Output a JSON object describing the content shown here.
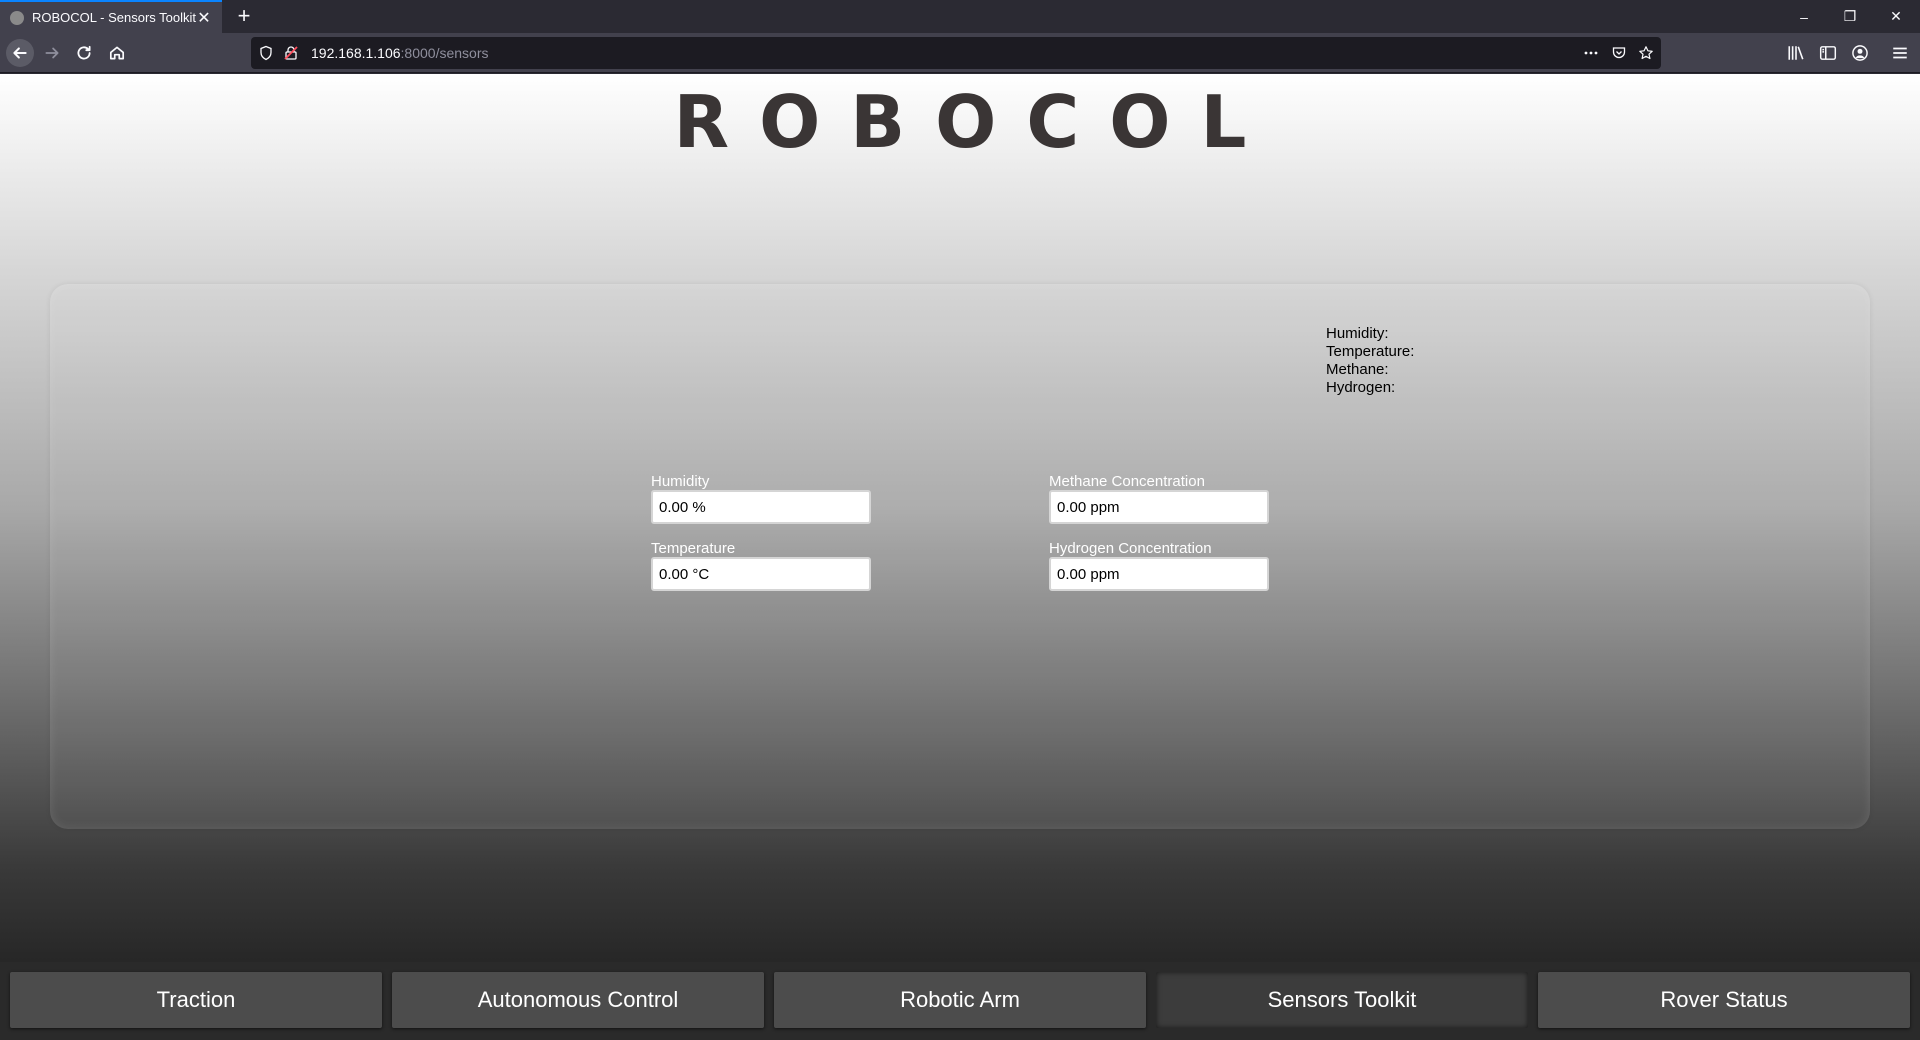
{
  "browser": {
    "tab_title": "ROBOCOL - Sensors Toolkit",
    "tab_close": "✕",
    "new_tab": "+",
    "url_host": "192.168.1.106",
    "url_rest": ":8000/sensors",
    "window_controls": [
      "–",
      "❐",
      "✕"
    ]
  },
  "header": {
    "logo": "ROBOCOL"
  },
  "readouts": {
    "humidity": "Humidity:",
    "temperature": "Temperature:",
    "methane": "Methane:",
    "hydrogen": "Hydrogen:"
  },
  "sensors": {
    "humidity": {
      "label": "Humidity",
      "value": "0.00 %"
    },
    "temperature": {
      "label": "Temperature",
      "value": "0.00 °C"
    },
    "methane": {
      "label": "Methane Concentration",
      "value": "0.00 ppm"
    },
    "hydrogen": {
      "label": "Hydrogen Concentration",
      "value": "0.00 ppm"
    }
  },
  "nav": {
    "tabs": [
      "Traction",
      "Autonomous Control",
      "Robotic Arm",
      "Sensors Toolkit",
      "Rover Status"
    ],
    "active": "Sensors Toolkit"
  },
  "colors": {
    "browser_dark": "#2b2a33",
    "browser_toolbar": "#42414d",
    "logo": "#3a3535",
    "nav_tab": "#4c4c4c",
    "nav_tab_active": "#3c3c3c",
    "accent": "#0a84ff"
  }
}
